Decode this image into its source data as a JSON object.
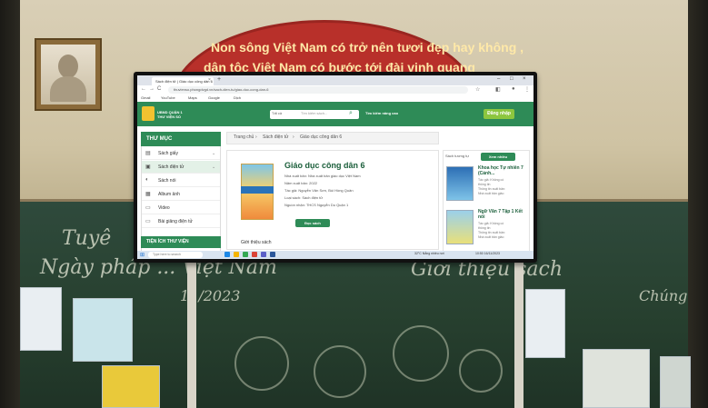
{
  "scene": {
    "banner_lines": [
      "Non sông Việt Nam có trở nên tươi đẹp hay không ,",
      "dân tộc Việt Nam có bước tới đài vinh quang"
    ],
    "chalk_left_1": "Tuyê",
    "chalk_left_2": "Ngày  pháp  ... Việt  Nam",
    "chalk_date": "11/2023",
    "chalk_right_1": "Giới  thiệu  sách",
    "chalk_right_2": "Chúng"
  },
  "browser": {
    "tab_title": "Sách điện tử | Giáo dục công dân 6",
    "new_tab": "+",
    "window_controls": [
      "–",
      "□",
      "×"
    ],
    "nav": [
      "←",
      "→",
      "C"
    ],
    "address": "thuvienso.phongdvgd.vn/sach-dien-tu/giao-duc-cong-dan-6",
    "bookmarks": [
      "Gmail",
      "YouTube",
      "Maps",
      "Google",
      "Dịch"
    ]
  },
  "site": {
    "name_line1": "UBND QUẬN 1",
    "name_line2": "THƯ VIỆN SỐ",
    "search_select": "Tất cả",
    "search_placeholder": "Tìm kiếm sách...",
    "advanced_search": "Tìm kiếm nâng cao",
    "login": "Đăng nhập",
    "sidebar_title": "THƯ MỤC",
    "sidebar_items": [
      {
        "icon": "▤",
        "label": "Sách giấy"
      },
      {
        "icon": "▣",
        "label": "Sách điện tử"
      },
      {
        "icon": "◐",
        "label": "Sách nói"
      },
      {
        "icon": "▦",
        "label": "Album ảnh"
      },
      {
        "icon": "▭",
        "label": "Video"
      },
      {
        "icon": "▭",
        "label": "Bài giảng điện tử"
      }
    ],
    "utilities_title": "TIỆN ÍCH THƯ VIỆN",
    "breadcrumb": [
      "Trang chủ",
      "›",
      "Sách điện tử",
      "›",
      "Giáo dục công dân 6"
    ],
    "book": {
      "title": "Giáo dục công dân 6",
      "meta": [
        "Nhà xuất bản: Nhà xuất bản giáo dục Việt Nam",
        "Năm xuất bản: 2022",
        "Tác giả: Nguyễn Văn Sơn, Bùi Hồng Quân",
        "Loại sách: Sách điện tử",
        "Nguồn nhận: THCS Nguyễn Du Quận 1"
      ],
      "read_button": "Đọc sách",
      "intro_heading": "Giới thiệu sách"
    },
    "related": {
      "tab_related": "Sách tương tự",
      "tab_featured": "Xem nhiều",
      "items": [
        {
          "title": "Khoa học Tự nhiên 7 (Cánh...",
          "meta": [
            "Tác giả: Không có",
            "thông tin",
            "Thông tin xuất bản:",
            "Nhà xuất bản giáo"
          ]
        },
        {
          "title": "Ngữ Văn 7 Tập 1 Kết nối",
          "meta": [
            "Tác giả: Không có",
            "thông tin",
            "Thông tin xuất bản:",
            "Nhà xuất bản giáo"
          ]
        }
      ]
    }
  },
  "taskbar": {
    "start": "⊞",
    "search_placeholder": "Type here to search",
    "weather": "32°C  Nắng nhiều nơi",
    "clock": "10:50  16/11/2023"
  }
}
